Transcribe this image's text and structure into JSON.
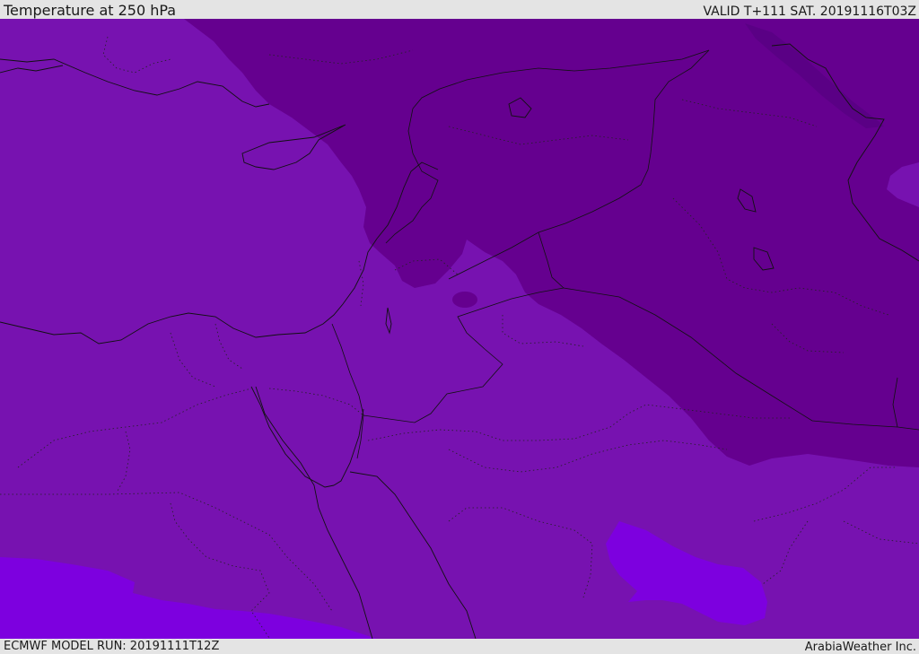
{
  "header": {
    "title": "Temperature at 250 hPa",
    "valid": "VALID T+111 SAT. 20191116T03Z"
  },
  "footer": {
    "model_run": "ECMWF MODEL RUN: 20191111T12Z",
    "credit": "ArabiaWeather Inc."
  },
  "map": {
    "colors": {
      "base": "#7712b0",
      "cold": "#65008f",
      "coldest": "#5a0085",
      "warm": "#7d00df"
    }
  }
}
